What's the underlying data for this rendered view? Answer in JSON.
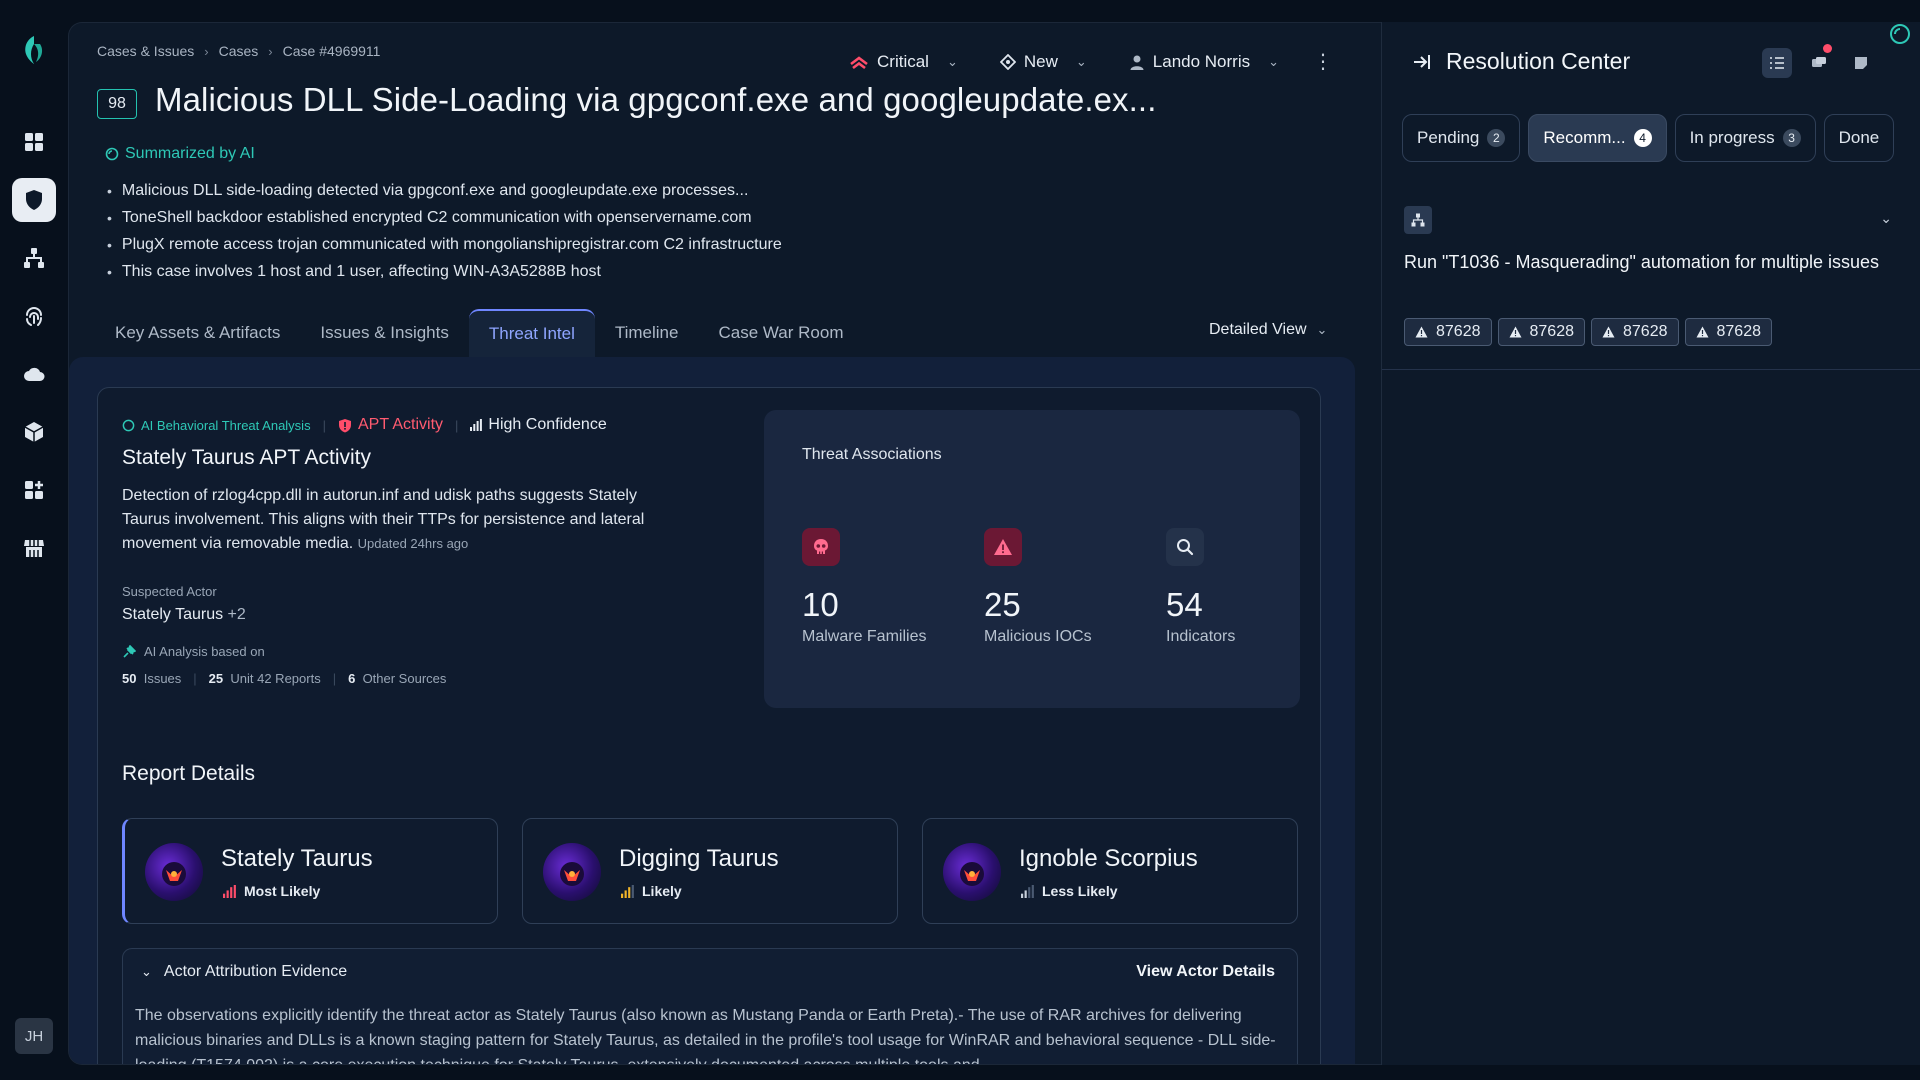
{
  "rail": {
    "avatar_initials": "JH",
    "icons": [
      "logo-icon",
      "dashboard-icon",
      "shield-icon",
      "network-icon",
      "fingerprint-icon",
      "cloud-icon",
      "cube-icon",
      "apps-add-icon",
      "marketplace-icon"
    ]
  },
  "breadcrumb": {
    "items": [
      "Cases & Issues",
      "Cases",
      "Case #4969911"
    ],
    "separator": "›"
  },
  "controls": {
    "severity": "Critical",
    "status": "New",
    "assignee": "Lando Norris"
  },
  "case": {
    "score": "98",
    "title": "Malicious DLL Side-Loading via gpgconf.exe and googleupdate.ex..."
  },
  "summary": {
    "label": "Summarized by AI",
    "bullets": [
      "Malicious DLL side-loading detected via gpgconf.exe and googleupdate.exe processes...",
      "ToneShell backdoor established encrypted C2 communication with openservername.com",
      "PlugX remote access trojan communicated with mongolianshipregistrar.com C2 infrastructure",
      "This case involves 1 host and 1 user, affecting WIN-A3A5288B host"
    ]
  },
  "tabs": [
    "Key Assets & Artifacts",
    "Issues & Insights",
    "Threat Intel",
    "Timeline",
    "Case War Room"
  ],
  "view_selector": "Detailed View",
  "analysis": {
    "tag": "AI Behavioral Threat Analysis",
    "activity": "APT Activity",
    "confidence": "High Confidence",
    "title": "Stately Taurus APT Activity",
    "description": "Detection of rzlog4cpp.dll in autorun.inf and udisk paths suggests Stately Taurus involvement. This aligns with their TTPs for persistence and lateral movement via removable media.",
    "updated": "Updated 24hrs ago",
    "suspected_actor_label": "Suspected Actor",
    "suspected_actor": "Stately Taurus",
    "suspected_actor_extra": "+2",
    "based_on_label": "AI Analysis based on",
    "sources": [
      {
        "count": "50",
        "label": "Issues"
      },
      {
        "count": "25",
        "label": "Unit 42 Reports"
      },
      {
        "count": "6",
        "label": "Other Sources"
      }
    ]
  },
  "associations": {
    "title": "Threat Associations",
    "stats": [
      {
        "value": "10",
        "label": "Malware Families",
        "icon": "skull-icon",
        "color": "#ff4d7a"
      },
      {
        "value": "25",
        "label": "Malicious IOCs",
        "icon": "warning-icon",
        "color": "#ff4d7a"
      },
      {
        "value": "54",
        "label": "Indicators",
        "icon": "search-icon",
        "color": "#e6ecf3"
      }
    ]
  },
  "report": {
    "title": "Report Details",
    "actors": [
      {
        "name": "Stately Taurus",
        "likelihood": "Most Likely",
        "color": "#ff4d6a"
      },
      {
        "name": "Digging Taurus",
        "likelihood": "Likely",
        "color": "#f0b429"
      },
      {
        "name": "Ignoble Scorpius",
        "likelihood": "Less Likely",
        "color": "#c7d0dc"
      }
    ],
    "evidence_title": "Actor Attribution Evidence",
    "evidence_link": "View Actor Details",
    "evidence_text": "The observations explicitly identify the threat actor as Stately Taurus (also known as Mustang Panda or Earth Preta).- The use of RAR archives for delivering malicious binaries and DLLs is a known staging pattern for Stately Taurus, as detailed in the profile's tool usage for WinRAR and behavioral sequence - DLL side-loading (T1574.002) is a core execution technique for Stately Taurus, extensively documented across multiple tools and"
  },
  "resolution": {
    "title": "Resolution Center",
    "tabs": [
      {
        "label": "Pending",
        "count": "2"
      },
      {
        "label": "Recomm...",
        "count": "4"
      },
      {
        "label": "In progress",
        "count": "3"
      },
      {
        "label": "Done",
        "count": ""
      }
    ],
    "recommendation": "Run \"T1036 - Masquerading\" automation for multiple issues",
    "chips": [
      "87628",
      "87628",
      "87628",
      "87628"
    ]
  }
}
